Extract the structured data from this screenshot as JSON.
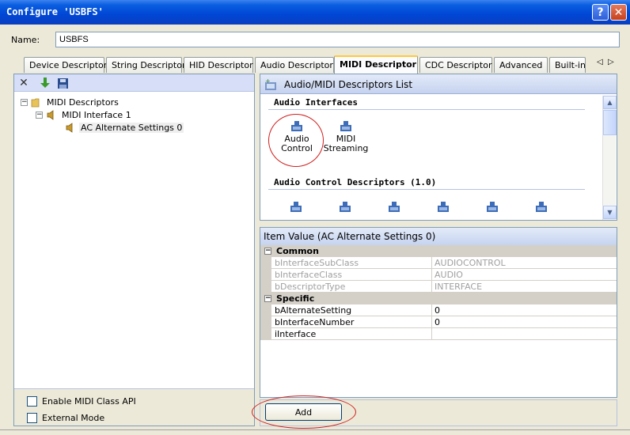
{
  "window": {
    "title": "Configure 'USBFS'"
  },
  "name_field": {
    "label": "Name:",
    "value": "USBFS"
  },
  "tabs": [
    {
      "label": "Device Descriptor"
    },
    {
      "label": "String Descriptor"
    },
    {
      "label": "HID Descriptor"
    },
    {
      "label": "Audio Descriptor"
    },
    {
      "label": "MIDI Descriptor"
    },
    {
      "label": "CDC Descriptor"
    },
    {
      "label": "Advanced"
    },
    {
      "label": "Built-in"
    }
  ],
  "tabs_scroll": {
    "left": "◁",
    "right": "▷"
  },
  "tree": {
    "root": "MIDI Descriptors",
    "interface": "MIDI Interface 1",
    "setting": "AC Alternate Settings 0"
  },
  "list_panel": {
    "header": "Audio/MIDI Descriptors List",
    "section1": "Audio Interfaces",
    "items1": [
      {
        "line1": "Audio",
        "line2": "Control"
      },
      {
        "line1": "MIDI",
        "line2": "Streaming"
      }
    ],
    "section2": "Audio Control Descriptors (1.0)"
  },
  "property_grid": {
    "header": "Item Value (AC Alternate Settings 0)",
    "common_label": "Common",
    "common": [
      {
        "name": "bInterfaceSubClass",
        "value": "AUDIOCONTROL"
      },
      {
        "name": "bInterfaceClass",
        "value": "AUDIO"
      },
      {
        "name": "bDescriptorType",
        "value": "INTERFACE"
      }
    ],
    "specific_label": "Specific",
    "specific": [
      {
        "name": "bAlternateSetting",
        "value": "0"
      },
      {
        "name": "bInterfaceNumber",
        "value": "0"
      },
      {
        "name": "iInterface",
        "value": ""
      }
    ]
  },
  "options": {
    "enable_midi": "Enable MIDI Class API",
    "external_mode": "External Mode"
  },
  "buttons": {
    "add": "Add",
    "help": "?",
    "close": "✕"
  },
  "toolbar": {
    "delete_glyph": "✕"
  },
  "tree_glyphs": {
    "minus": "−"
  },
  "colors": {
    "titlebar": "#0a5fe0",
    "annotation_red": "#d0201e",
    "active_tab_accent": "#ffc83c"
  }
}
